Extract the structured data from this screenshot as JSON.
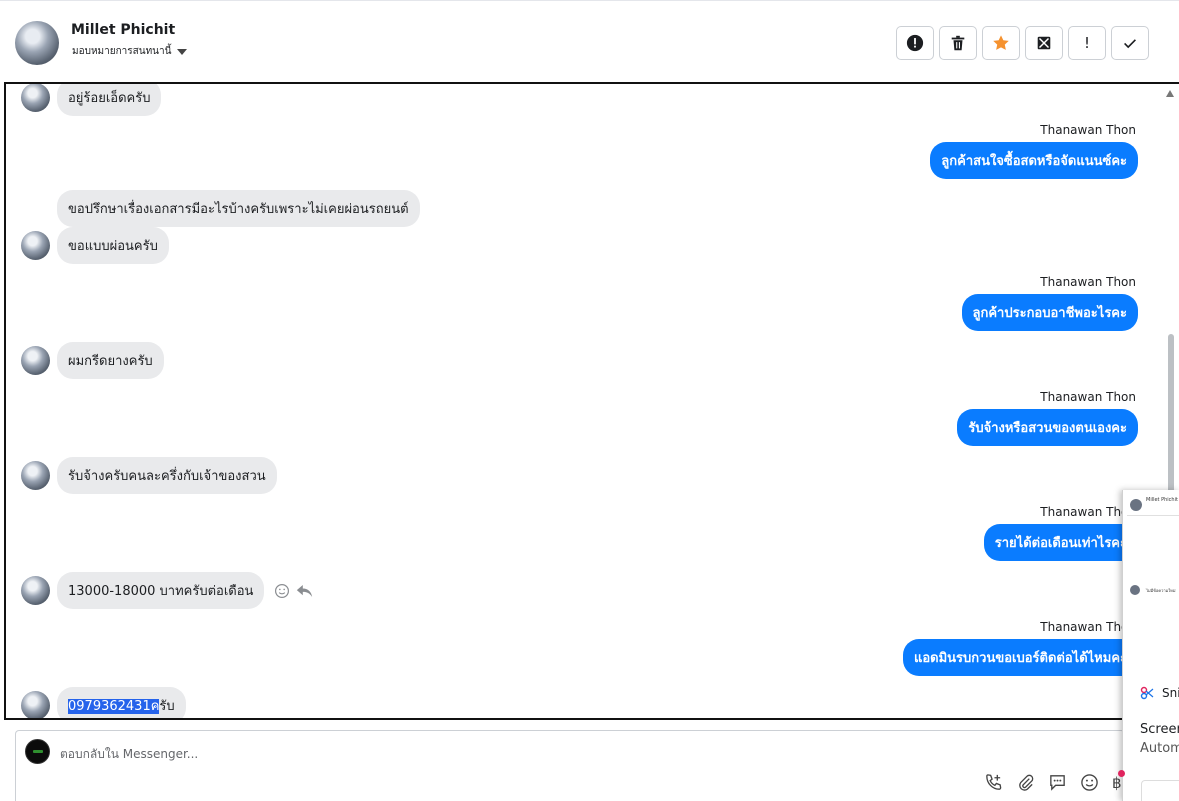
{
  "header": {
    "name": "Millet Phichit",
    "assign_label": "มอบหมายการสนทนานี้",
    "actions": [
      {
        "icon": "alert-circle-icon",
        "name": "spam-button"
      },
      {
        "icon": "trash-icon",
        "name": "delete-button"
      },
      {
        "icon": "star-icon",
        "name": "star-button"
      },
      {
        "icon": "mark-unread-icon",
        "name": "mark-unread-button"
      },
      {
        "icon": "exclamation-icon",
        "name": "follow-up-button",
        "label": "!"
      },
      {
        "icon": "check-icon",
        "name": "done-button"
      }
    ],
    "star_color": "#f5922f"
  },
  "messages": [
    {
      "dir": "in",
      "text": "อยู่ร้อยเอ็ดครับ"
    },
    {
      "dir": "out",
      "sender": "Thanawan Thon",
      "text": "ลูกค้าสนใจซื้อสดหรือจัดแนนซ์คะ"
    },
    {
      "dir": "in",
      "text": "ขอปรึกษาเรื่องเอกสารมีอะไรบ้างครับเพราะไม่เคยผ่อนรถยนต์"
    },
    {
      "dir": "in",
      "text": "ขอแบบผ่อนครับ"
    },
    {
      "dir": "out",
      "sender": "Thanawan Thon",
      "text": "ลูกค้าประกอบอาชีพอะไรคะ"
    },
    {
      "dir": "in",
      "text": "ผมกรีดยางครับ"
    },
    {
      "dir": "out",
      "sender": "Thanawan Thon",
      "text": "รับจ้างหรือสวนของตนเองคะ"
    },
    {
      "dir": "in",
      "text": "รับจ้างครับคนละครึ่งกับเจ้าของสวน"
    },
    {
      "dir": "out",
      "sender": "Thanawan Thon",
      "text": "รายได้ต่อเดือนเท่าไรคะ"
    },
    {
      "dir": "in",
      "text": "13000-18000 บาทครับต่อเดือน"
    },
    {
      "dir": "out",
      "sender": "Thanawan Thon",
      "text": "แอดมินรบกวนขอเบอร์ติดต่อได้ไหมคะ"
    },
    {
      "dir": "in",
      "text_selected": "0979362431ค",
      "text_rest": "รับ"
    }
  ],
  "composer": {
    "placeholder": "ตอบกลับใน Messenger..."
  },
  "overlay": {
    "thumb1_text": "Millet Phichit",
    "thumb2_text": "ไม่มีข้อความใหม่",
    "snip_label": "Sni",
    "screen_label": "Screen",
    "auto_label": "Autom"
  },
  "colors": {
    "outgoing_bubble": "#0a7cff",
    "incoming_bubble": "#e9eaec",
    "selection": "#2563eb"
  }
}
